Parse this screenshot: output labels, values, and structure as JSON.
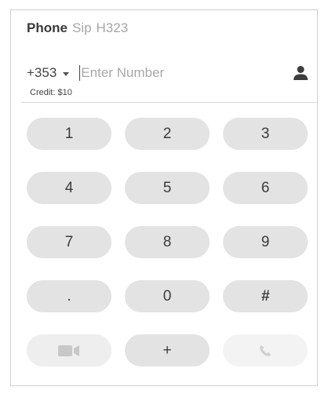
{
  "tabs": [
    {
      "label": "Phone",
      "active": true
    },
    {
      "label": "Sip",
      "active": false
    },
    {
      "label": "H323",
      "active": false
    }
  ],
  "dialer": {
    "country_code": "+353",
    "number_value": "",
    "number_placeholder": "Enter Number",
    "credit": "Credit: $10",
    "contact_icon": "person-icon"
  },
  "keypad": {
    "keys": [
      "1",
      "2",
      "3",
      "4",
      "5",
      "6",
      "7",
      "8",
      "9",
      ".",
      "0",
      "#"
    ],
    "bottom": {
      "left_icon": "video-camera-icon",
      "center_label": "+",
      "right_icon": "phone-handset-icon"
    }
  },
  "colors": {
    "key_bg": "#e3e3e3",
    "key_disabled_bg": "#f1f1f1",
    "icon_gray": "#c9c9c9",
    "text_dark": "#3c3c3c"
  }
}
